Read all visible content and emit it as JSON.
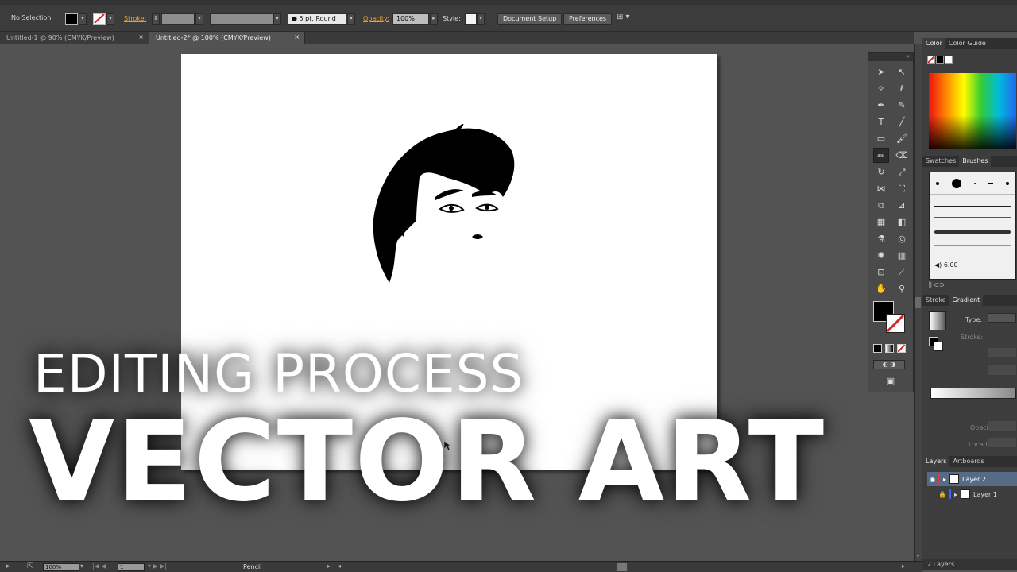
{
  "control_bar": {
    "selection_label": "No Selection",
    "stroke_label": "Stroke:",
    "brush_value": "5 pt. Round",
    "opacity_label": "Opacity:",
    "opacity_value": "100%",
    "style_label": "Style:",
    "document_setup_label": "Document Setup",
    "preferences_label": "Preferences"
  },
  "doc_tabs": [
    {
      "label": "Untitled-1 @ 90% (CMYK/Preview)",
      "close": "×"
    },
    {
      "label": "Untitled-2* @ 100% (CMYK/Preview)",
      "close": "×"
    }
  ],
  "panels": {
    "color_tabs": [
      "Color",
      "Color Guide"
    ],
    "swatch_tabs": [
      "Swatches",
      "Brushes"
    ],
    "brush_size": "6.00",
    "stroke_tabs": [
      "Stroke",
      "Gradient"
    ],
    "gradient_type_label": "Type:",
    "gradient_stroke_label": "Stroke:",
    "opacity_label": "Opacity:",
    "location_label": "Location:",
    "layers_tabs": [
      "Layers",
      "Artboards"
    ],
    "layers": [
      {
        "name": "Layer 2"
      },
      {
        "name": "Layer 1"
      }
    ],
    "layers_count": "2 Layers"
  },
  "status_bar": {
    "zoom": "100%",
    "page": "1",
    "tool_name": "Pencil"
  },
  "overlay": {
    "line1": "EDITING PROCESS",
    "line2": "VECTOR ART"
  },
  "colors": {
    "accent_orange": "#e8a23a",
    "ui_dark": "#3c3c3c",
    "canvas_bg": "#535353"
  }
}
